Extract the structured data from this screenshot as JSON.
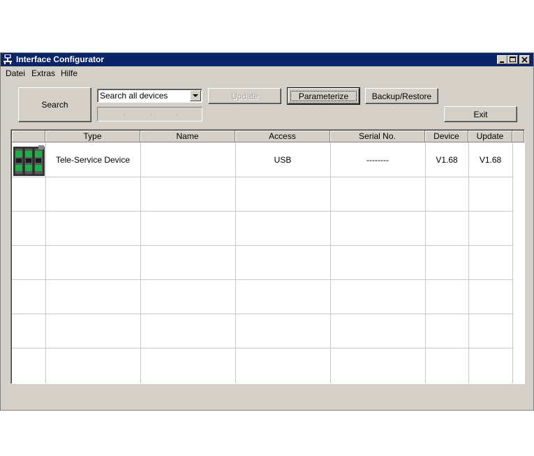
{
  "window": {
    "title": "Interface Configurator",
    "icon": "network-computer-icon"
  },
  "menu": [
    "Datei",
    "Extras",
    "Hilfe"
  ],
  "toolbar": {
    "search_label": "Search",
    "combo_value": "Search all devices",
    "update_label": "Update",
    "parameterize_label": "Parameterize",
    "backup_label": "Backup/Restore",
    "exit_label": "Exit"
  },
  "table": {
    "columns": [
      "",
      "Type",
      "Name",
      "Access",
      "Serial No.",
      "Device",
      "Update"
    ],
    "rows": [
      {
        "icon": "device-module-icon",
        "type": "Tele-Service Device",
        "name": "",
        "access": "USB",
        "serial": "--------",
        "device": "V1.68",
        "update": "V1.68"
      }
    ]
  },
  "colors": {
    "title_bar": "#0a246a",
    "window_bg": "#d4d0c8",
    "device_green": "#1fae4a"
  }
}
